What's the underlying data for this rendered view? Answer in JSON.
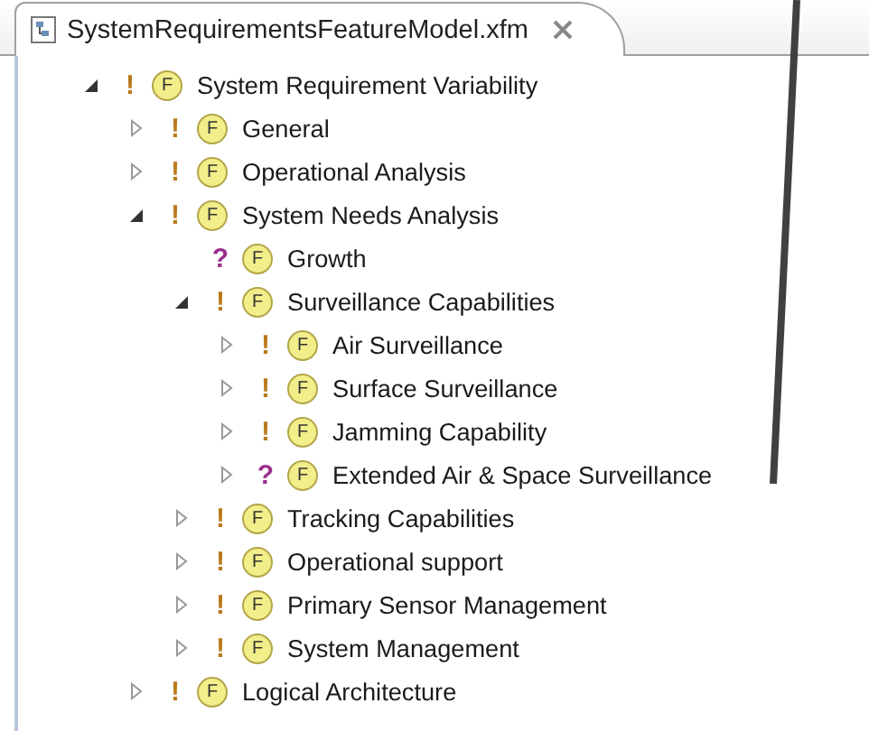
{
  "editor_tab": {
    "title": "SystemRequirementsFeatureModel.xfm",
    "selected": true
  },
  "tree": [
    {
      "label": "System Requirement Variability",
      "marker": "!",
      "optional": false,
      "badge": "F",
      "expandable": true,
      "expanded": true,
      "children": [
        {
          "label": "General",
          "marker": "!",
          "optional": false,
          "badge": "F",
          "expandable": true,
          "expanded": false
        },
        {
          "label": "Operational Analysis",
          "marker": "!",
          "optional": false,
          "badge": "F",
          "expandable": true,
          "expanded": false
        },
        {
          "label": "System Needs Analysis",
          "marker": "!",
          "optional": false,
          "badge": "F",
          "expandable": true,
          "expanded": true,
          "children": [
            {
              "label": "Growth",
              "marker": "?",
              "optional": true,
              "badge": "F",
              "expandable": false
            },
            {
              "label": "Surveillance Capabilities",
              "marker": "!",
              "optional": false,
              "badge": "F",
              "expandable": true,
              "expanded": true,
              "children": [
                {
                  "label": "Air Surveillance",
                  "marker": "!",
                  "optional": false,
                  "badge": "F",
                  "expandable": true,
                  "expanded": false
                },
                {
                  "label": "Surface Surveillance",
                  "marker": "!",
                  "optional": false,
                  "badge": "F",
                  "expandable": true,
                  "expanded": false
                },
                {
                  "label": "Jamming Capability",
                  "marker": "!",
                  "optional": false,
                  "badge": "F",
                  "expandable": true,
                  "expanded": false
                },
                {
                  "label": "Extended Air & Space Surveillance",
                  "marker": "?",
                  "optional": true,
                  "badge": "F",
                  "expandable": true,
                  "expanded": false
                }
              ]
            },
            {
              "label": "Tracking Capabilities",
              "marker": "!",
              "optional": false,
              "badge": "F",
              "expandable": true,
              "expanded": false
            },
            {
              "label": "Operational support",
              "marker": "!",
              "optional": false,
              "badge": "F",
              "expandable": true,
              "expanded": false
            },
            {
              "label": "Primary Sensor Management",
              "marker": "!",
              "optional": false,
              "badge": "F",
              "expandable": true,
              "expanded": false
            },
            {
              "label": "System Management",
              "marker": "!",
              "optional": false,
              "badge": "F",
              "expandable": true,
              "expanded": false
            }
          ]
        },
        {
          "label": "Logical Architecture",
          "marker": "!",
          "optional": false,
          "badge": "F",
          "expandable": true,
          "expanded": false
        }
      ]
    }
  ]
}
